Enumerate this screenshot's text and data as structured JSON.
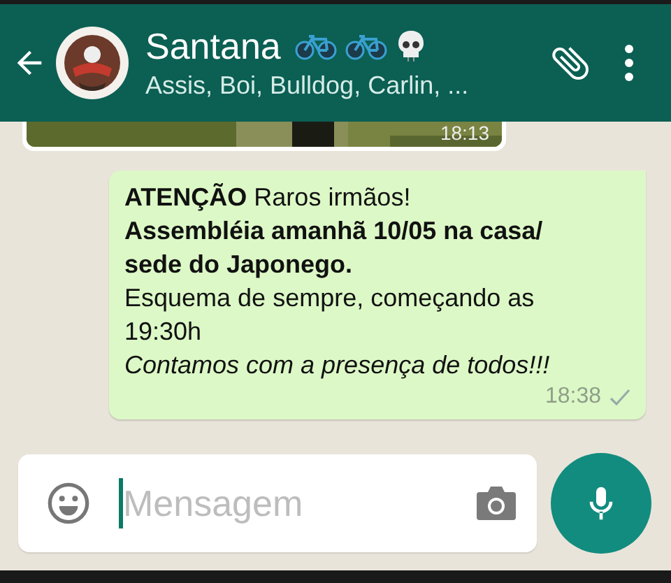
{
  "header": {
    "title": "Santana",
    "subtitle": "Assis, Boi, Bulldog, Carlin, ..."
  },
  "messages": [
    {
      "time": "18:13"
    },
    {
      "kind": "text",
      "text": "**ATENÇÃO** Raros irmãos!\n**Assembléia amanhã 10/05 na casa/\nsede do Japonego.**\nEsquema de sempre, começando as\n19:30h\n*Contamos com a presença de todos!!!*",
      "time": "18:38"
    }
  ],
  "composer": {
    "placeholder": "Mensagem"
  }
}
